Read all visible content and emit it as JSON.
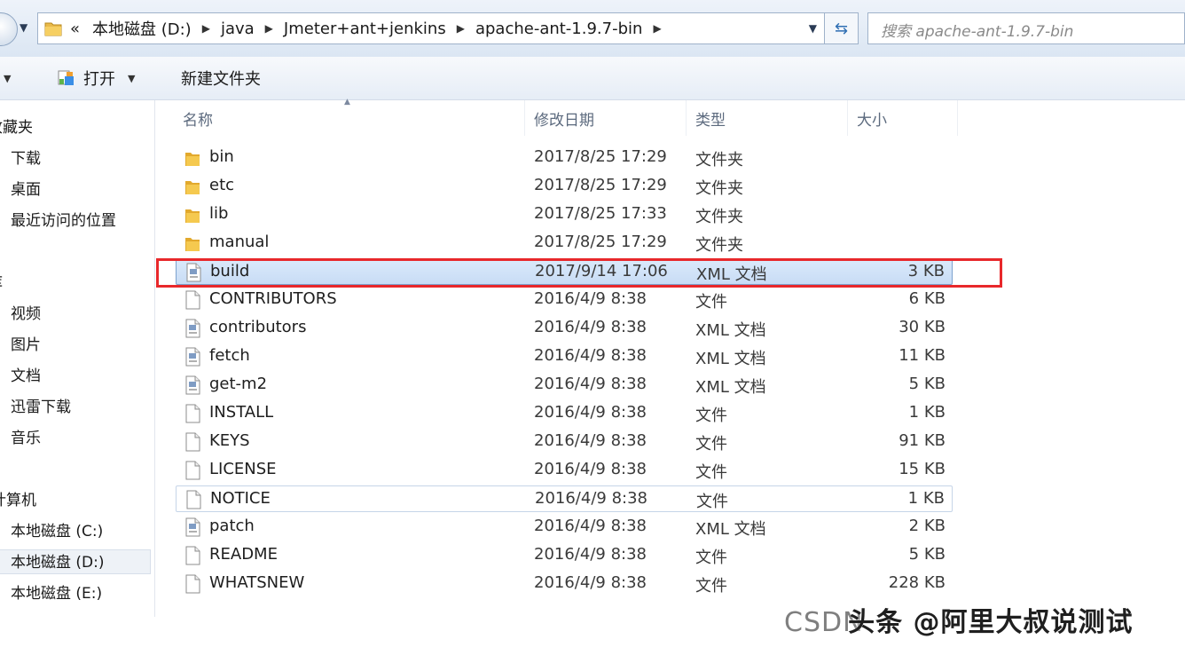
{
  "address": {
    "lead": "«",
    "crumbs": [
      "本地磁盘 (D:)",
      "java",
      "Jmeter+ant+jenkins",
      "apache-ant-1.9.7-bin"
    ],
    "search_placeholder": "搜索 apache-ant-1.9.7-bin"
  },
  "toolbar": {
    "open_label": "打开",
    "new_folder_label": "新建文件夹"
  },
  "sidebar": {
    "items": [
      "收藏夹",
      "下载",
      "桌面",
      "最近访问的位置",
      "库",
      "视频",
      "图片",
      "文档",
      "迅雷下载",
      "音乐",
      "计算机",
      "本地磁盘 (C:)",
      "本地磁盘 (D:)",
      "本地磁盘 (E:)"
    ]
  },
  "columns": {
    "name": "名称",
    "date": "修改日期",
    "type": "类型",
    "size": "大小"
  },
  "files": [
    {
      "name": "bin",
      "date": "2017/8/25 17:29",
      "type": "文件夹",
      "size": "",
      "icon": "folder-icon"
    },
    {
      "name": "etc",
      "date": "2017/8/25 17:29",
      "type": "文件夹",
      "size": "",
      "icon": "folder-icon"
    },
    {
      "name": "lib",
      "date": "2017/8/25 17:33",
      "type": "文件夹",
      "size": "",
      "icon": "folder-icon"
    },
    {
      "name": "manual",
      "date": "2017/8/25 17:29",
      "type": "文件夹",
      "size": "",
      "icon": "folder-icon"
    },
    {
      "name": "build",
      "date": "2017/9/14 17:06",
      "type": "XML 文档",
      "size": "3 KB",
      "icon": "xml-file-icon"
    },
    {
      "name": "CONTRIBUTORS",
      "date": "2016/4/9 8:38",
      "type": "文件",
      "size": "6 KB",
      "icon": "file-icon"
    },
    {
      "name": "contributors",
      "date": "2016/4/9 8:38",
      "type": "XML 文档",
      "size": "30 KB",
      "icon": "xml-file-icon"
    },
    {
      "name": "fetch",
      "date": "2016/4/9 8:38",
      "type": "XML 文档",
      "size": "11 KB",
      "icon": "xml-file-icon"
    },
    {
      "name": "get-m2",
      "date": "2016/4/9 8:38",
      "type": "XML 文档",
      "size": "5 KB",
      "icon": "xml-file-icon"
    },
    {
      "name": "INSTALL",
      "date": "2016/4/9 8:38",
      "type": "文件",
      "size": "1 KB",
      "icon": "file-icon"
    },
    {
      "name": "KEYS",
      "date": "2016/4/9 8:38",
      "type": "文件",
      "size": "91 KB",
      "icon": "file-icon"
    },
    {
      "name": "LICENSE",
      "date": "2016/4/9 8:38",
      "type": "文件",
      "size": "15 KB",
      "icon": "file-icon"
    },
    {
      "name": "NOTICE",
      "date": "2016/4/9 8:38",
      "type": "文件",
      "size": "1 KB",
      "icon": "file-icon"
    },
    {
      "name": "patch",
      "date": "2016/4/9 8:38",
      "type": "XML 文档",
      "size": "2 KB",
      "icon": "xml-file-icon"
    },
    {
      "name": "README",
      "date": "2016/4/9 8:38",
      "type": "文件",
      "size": "5 KB",
      "icon": "file-icon"
    },
    {
      "name": "WHATSNEW",
      "date": "2016/4/9 8:38",
      "type": "文件",
      "size": "228 KB",
      "icon": "file-icon"
    }
  ],
  "watermark": {
    "prefix": "CSDN",
    "brand": "头条 @阿里大叔说测试"
  },
  "colors": {
    "highlight": "#e8282b",
    "selection": "#c8dcf5"
  }
}
